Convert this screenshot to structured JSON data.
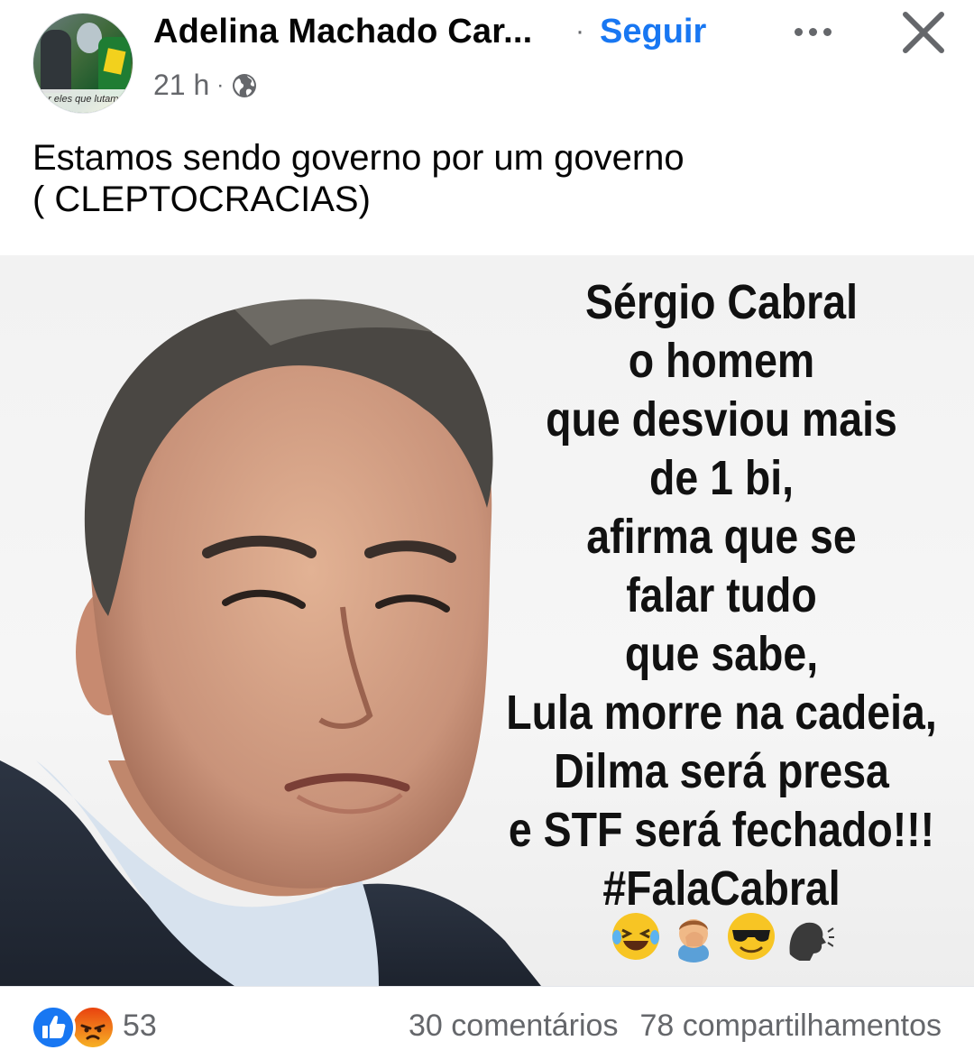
{
  "post": {
    "author_name": "Adelina Machado Car...",
    "separator": "·",
    "follow_label": "Seguir",
    "time": "21 h",
    "meta_separator": "·",
    "avatar_caption": "por eles que lutamos",
    "caption_lines": [
      "Estamos sendo governo por um governo",
      "( CLEPTOCRACIAS)"
    ]
  },
  "image": {
    "text_lines": [
      "Sérgio Cabral",
      "o homem",
      "que desviou mais",
      "de 1 bi,",
      "afirma que se",
      "falar tudo",
      "que sabe,",
      "Lula morre na cadeia,",
      "Dilma será presa",
      "e STF será fechado!!!",
      "#FalaCabral"
    ],
    "emojis": [
      "laughing-tears",
      "facepalm",
      "sunglasses-face",
      "speaking-head"
    ]
  },
  "footer": {
    "reaction_count": "53",
    "comments": "30 comentários",
    "shares": "78 compartilhamentos"
  },
  "colors": {
    "accent": "#1877f2",
    "secondary_text": "#65676b",
    "primary_text": "#050505"
  }
}
